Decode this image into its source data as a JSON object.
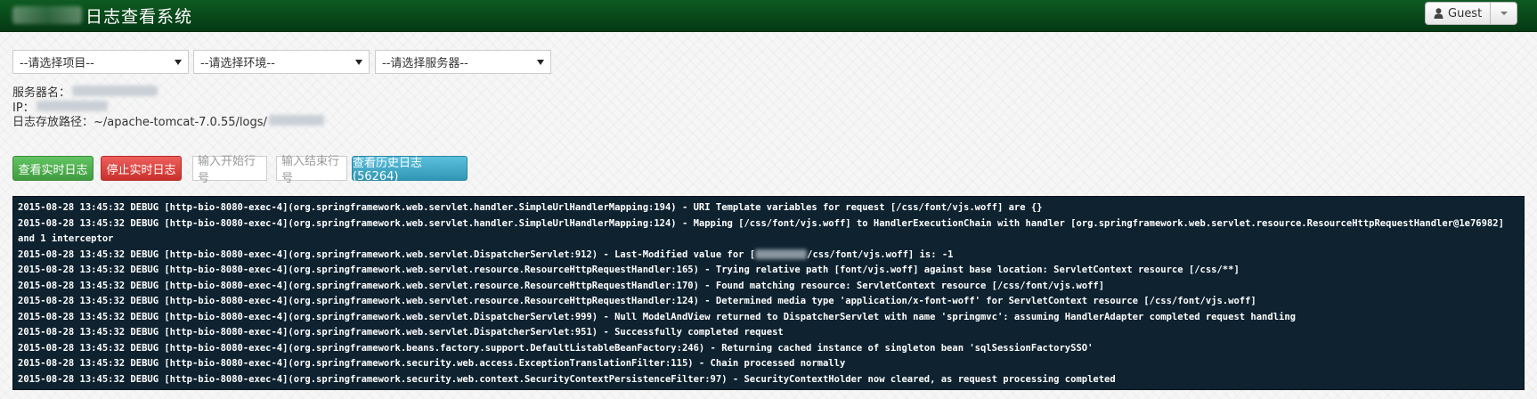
{
  "header": {
    "title": "日志查看系统",
    "user_label": "Guest"
  },
  "selects": {
    "project": "--请选择项目--",
    "env": "--请选择环境--",
    "server": "--请选择服务器--"
  },
  "info": {
    "server_name_label": "服务器名：",
    "ip_label": "IP：",
    "log_path_label": "日志存放路径：~/apache-tomcat-7.0.55/logs/"
  },
  "controls": {
    "view_realtime": "查看实时日志",
    "stop_realtime": "停止实时日志",
    "start_line_placeholder": "输入开始行号",
    "dash": "-",
    "end_line_placeholder": "输入结束行号",
    "view_history": "查看历史日志(56264)"
  },
  "logs": [
    "2015-08-28 13:45:32 DEBUG [http-bio-8080-exec-4](org.springframework.web.servlet.handler.SimpleUrlHandlerMapping:194) - URI Template variables for request [/css/font/vjs.woff] are {}",
    "2015-08-28 13:45:32 DEBUG [http-bio-8080-exec-4](org.springframework.web.servlet.handler.SimpleUrlHandlerMapping:124) - Mapping [/css/font/vjs.woff] to HandlerExecutionChain with handler [org.springframework.web.servlet.resource.ResourceHttpRequestHandler@1e76982] and 1 interceptor",
    "2015-08-28 13:45:32 DEBUG [http-bio-8080-exec-4](org.springframework.web.servlet.DispatcherServlet:912) - Last-Modified value for [",
    "/css/font/vjs.woff] is: -1",
    "2015-08-28 13:45:32 DEBUG [http-bio-8080-exec-4](org.springframework.web.servlet.resource.ResourceHttpRequestHandler:165) - Trying relative path [font/vjs.woff] against base location: ServletContext resource [/css/**]",
    "2015-08-28 13:45:32 DEBUG [http-bio-8080-exec-4](org.springframework.web.servlet.resource.ResourceHttpRequestHandler:170) - Found matching resource: ServletContext resource [/css/font/vjs.woff]",
    "2015-08-28 13:45:32 DEBUG [http-bio-8080-exec-4](org.springframework.web.servlet.resource.ResourceHttpRequestHandler:124) - Determined media type 'application/x-font-woff' for ServletContext resource [/css/font/vjs.woff]",
    "2015-08-28 13:45:32 DEBUG [http-bio-8080-exec-4](org.springframework.web.servlet.DispatcherServlet:999) - Null ModelAndView returned to DispatcherServlet with name 'springmvc': assuming HandlerAdapter completed request handling",
    "2015-08-28 13:45:32 DEBUG [http-bio-8080-exec-4](org.springframework.web.servlet.DispatcherServlet:951) - Successfully completed request",
    "2015-08-28 13:45:32 DEBUG [http-bio-8080-exec-4](org.springframework.beans.factory.support.DefaultListableBeanFactory:246) - Returning cached instance of singleton bean 'sqlSessionFactorySSO'",
    "2015-08-28 13:45:32 DEBUG [http-bio-8080-exec-4](org.springframework.security.web.access.ExceptionTranslationFilter:115) - Chain processed normally",
    "2015-08-28 13:45:32 DEBUG [http-bio-8080-exec-4](org.springframework.security.web.context.SecurityContextPersistenceFilter:97) - SecurityContextHolder now cleared, as request processing completed"
  ]
}
